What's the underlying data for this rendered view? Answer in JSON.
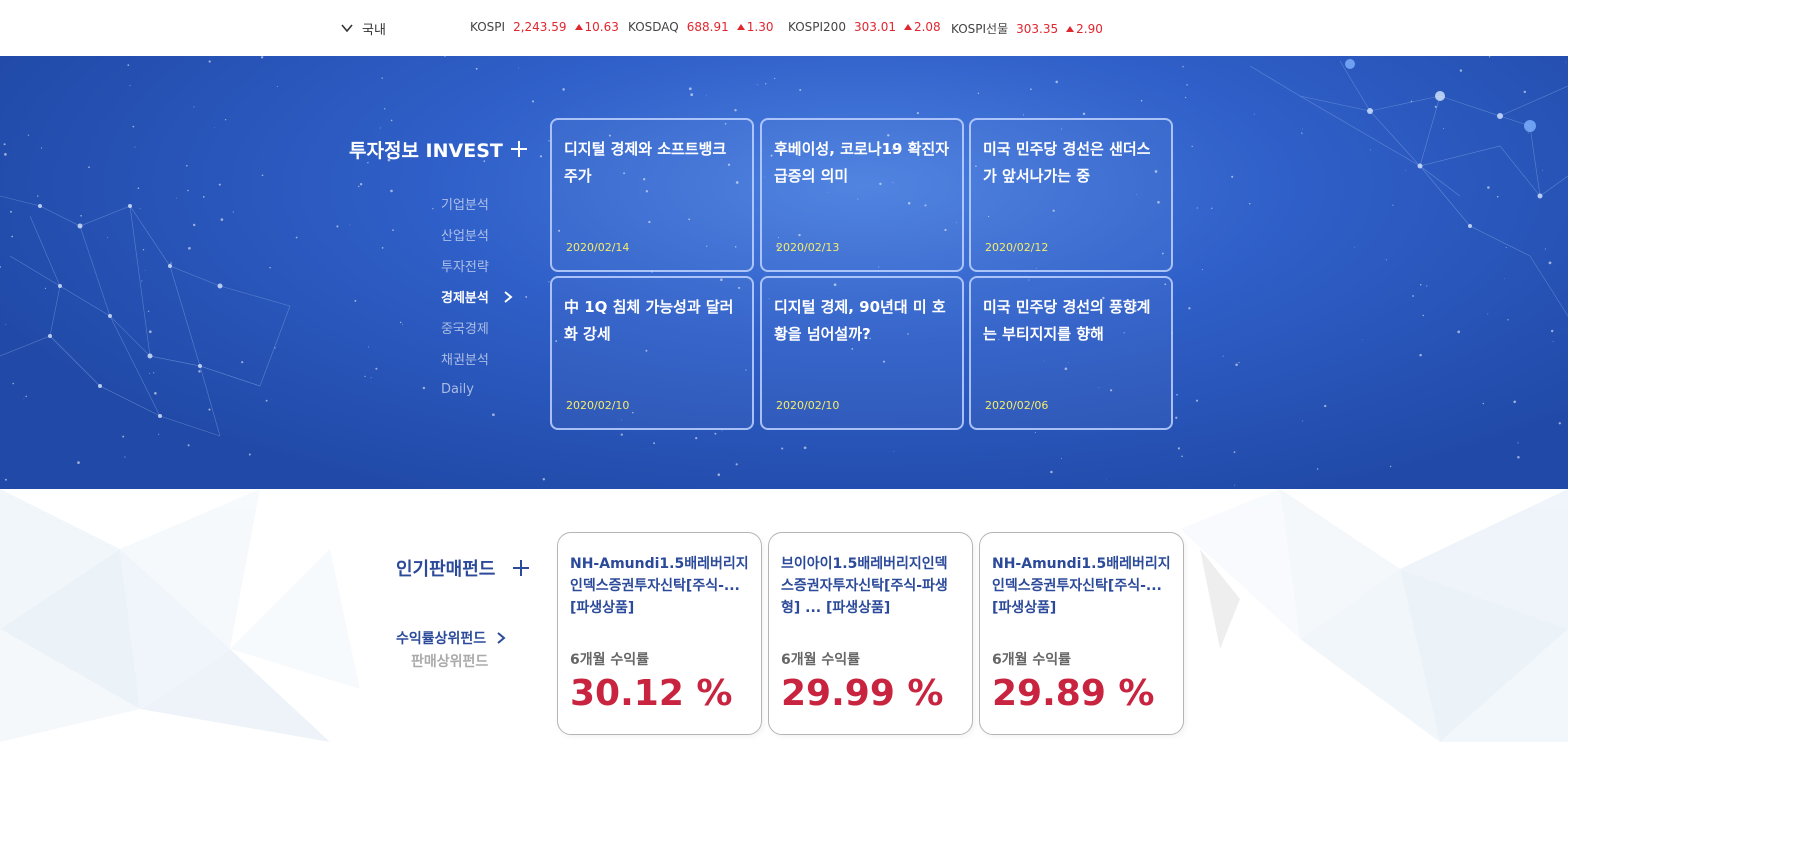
{
  "ticker": {
    "region": "국내",
    "indices": [
      {
        "name": "KOSPI",
        "value": "2,243.59",
        "change": "10.63"
      },
      {
        "name": "KOSDAQ",
        "value": "688.91",
        "change": "1.30"
      },
      {
        "name": "KOSPI200",
        "value": "303.01",
        "change": "2.08"
      },
      {
        "name": "KOSPI선물",
        "value": "303.35",
        "change": "2.90"
      }
    ],
    "up_color": "#e0262f"
  },
  "invest": {
    "title": "투자정보 INVEST",
    "menu": [
      {
        "label": "기업분석"
      },
      {
        "label": "산업분석"
      },
      {
        "label": "투자전략"
      },
      {
        "label": "경제분석",
        "active": true
      },
      {
        "label": "중국경제"
      },
      {
        "label": "채권분석"
      },
      {
        "label": "Daily"
      }
    ],
    "cards": [
      {
        "title": "디지털 경제와 소프트뱅크 주가",
        "date": "2020/02/14"
      },
      {
        "title": "후베이성, 코로나19 확진자 급증의 의미",
        "date": "2020/02/13"
      },
      {
        "title": "미국 민주당 경선은 샌더스가 앞서나가는 중",
        "date": "2020/02/12"
      },
      {
        "title": "中 1Q 침체 가능성과 달러화 강세",
        "date": "2020/02/10"
      },
      {
        "title": "디지털 경제, 90년대 미 호황을 넘어설까?",
        "date": "2020/02/10"
      },
      {
        "title": "미국 민주당 경선의 풍향계는 부티지지를 향해",
        "date": "2020/02/06"
      }
    ]
  },
  "funds": {
    "title": "인기판매펀드",
    "menu_active": "수익률상위펀드",
    "menu_other": "판매상위펀드",
    "return_label": "6개월 수익률",
    "items": [
      {
        "name": "NH-Amundi1.5배레버리지인덱스증권투자신탁[주식-... [파생상품]",
        "return": "30.12 %"
      },
      {
        "name": "브이아이1.5배레버리지인덱스증권자투자신탁[주식-파생형] ... [파생상품]",
        "return": "29.99 %"
      },
      {
        "name": "NH-Amundi1.5배레버리지인덱스증권투자신탁[주식-... [파생상품]",
        "return": "29.89 %"
      }
    ]
  }
}
